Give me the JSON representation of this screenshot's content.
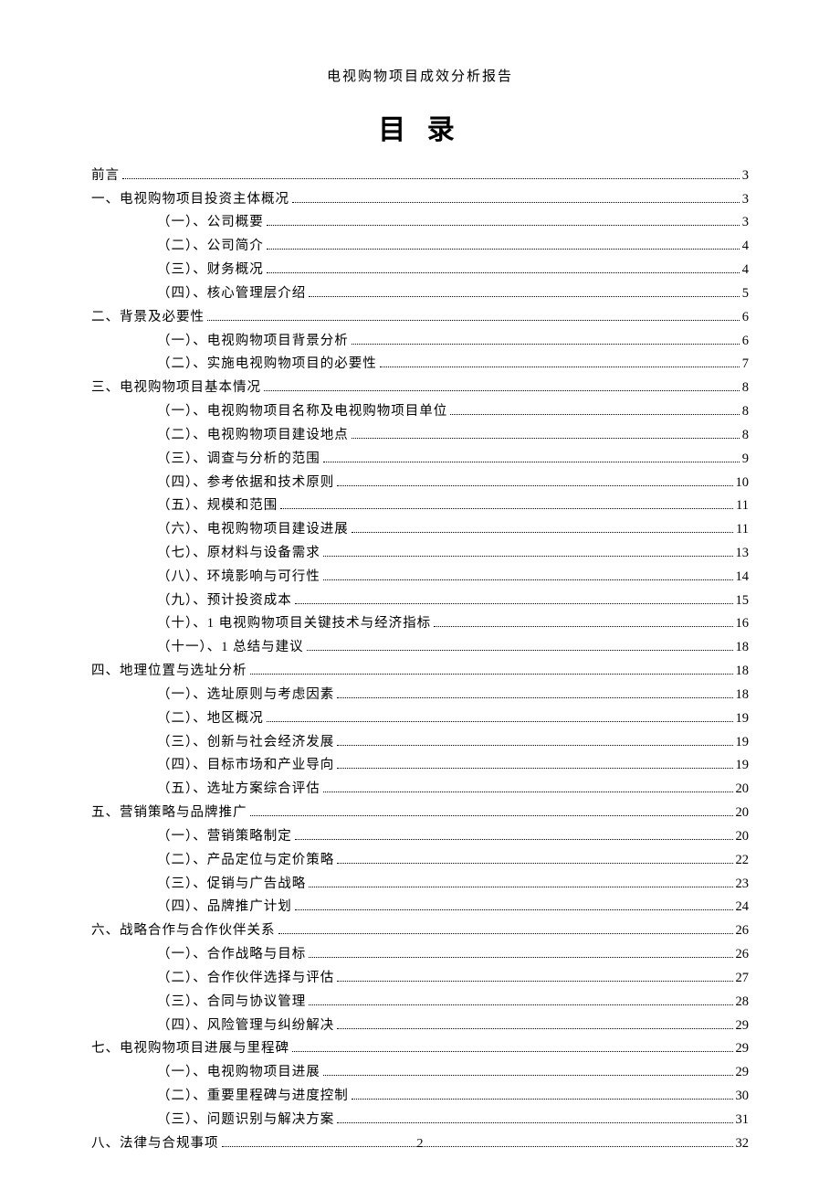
{
  "header": "电视购物项目成效分析报告",
  "title": "目 录",
  "pageNumber": "2",
  "toc": [
    {
      "label": "前言",
      "page": "3",
      "level": 1
    },
    {
      "label": "一、电视购物项目投资主体概况",
      "page": "3",
      "level": 1
    },
    {
      "label": "（一）、公司概要",
      "page": "3",
      "level": 2
    },
    {
      "label": "（二）、公司简介",
      "page": "4",
      "level": 2
    },
    {
      "label": "（三）、财务概况",
      "page": "4",
      "level": 2
    },
    {
      "label": "（四）、核心管理层介绍",
      "page": "5",
      "level": 2
    },
    {
      "label": "二、背景及必要性",
      "page": "6",
      "level": 1
    },
    {
      "label": "（一）、电视购物项目背景分析",
      "page": "6",
      "level": 2
    },
    {
      "label": "（二）、实施电视购物项目的必要性",
      "page": "7",
      "level": 2
    },
    {
      "label": "三、电视购物项目基本情况",
      "page": "8",
      "level": 1
    },
    {
      "label": "（一）、电视购物项目名称及电视购物项目单位",
      "page": "8",
      "level": 2
    },
    {
      "label": "（二）、电视购物项目建设地点",
      "page": "8",
      "level": 2
    },
    {
      "label": "（三）、调查与分析的范围",
      "page": "9",
      "level": 2
    },
    {
      "label": "（四）、参考依据和技术原则",
      "page": "10",
      "level": 2
    },
    {
      "label": "（五）、规模和范围",
      "page": "11",
      "level": 2
    },
    {
      "label": "（六）、电视购物项目建设进展",
      "page": "11",
      "level": 2
    },
    {
      "label": "（七）、原材料与设备需求",
      "page": "13",
      "level": 2
    },
    {
      "label": "（八）、环境影响与可行性",
      "page": "14",
      "level": 2
    },
    {
      "label": "（九）、预计投资成本",
      "page": "15",
      "level": 2
    },
    {
      "label": "（十）、1 电视购物项目关键技术与经济指标",
      "page": "16",
      "level": 2
    },
    {
      "label": "（十一）、1 总结与建议",
      "page": "18",
      "level": 2
    },
    {
      "label": "四、地理位置与选址分析",
      "page": "18",
      "level": 1
    },
    {
      "label": "（一）、选址原则与考虑因素",
      "page": "18",
      "level": 2
    },
    {
      "label": "（二）、地区概况",
      "page": "19",
      "level": 2
    },
    {
      "label": "（三）、创新与社会经济发展",
      "page": "19",
      "level": 2
    },
    {
      "label": "（四）、目标市场和产业导向",
      "page": "19",
      "level": 2
    },
    {
      "label": "（五）、选址方案综合评估",
      "page": "20",
      "level": 2
    },
    {
      "label": "五、营销策略与品牌推广",
      "page": "20",
      "level": 1
    },
    {
      "label": "（一）、营销策略制定",
      "page": "20",
      "level": 2
    },
    {
      "label": "（二）、产品定位与定价策略",
      "page": "22",
      "level": 2
    },
    {
      "label": "（三）、促销与广告战略",
      "page": "23",
      "level": 2
    },
    {
      "label": "（四）、品牌推广计划",
      "page": "24",
      "level": 2
    },
    {
      "label": "六、战略合作与合作伙伴关系",
      "page": "26",
      "level": 1
    },
    {
      "label": "（一）、合作战略与目标",
      "page": "26",
      "level": 2
    },
    {
      "label": "（二）、合作伙伴选择与评估",
      "page": "27",
      "level": 2
    },
    {
      "label": "（三）、合同与协议管理",
      "page": "28",
      "level": 2
    },
    {
      "label": "（四）、风险管理与纠纷解决",
      "page": "29",
      "level": 2
    },
    {
      "label": "七、电视购物项目进展与里程碑",
      "page": "29",
      "level": 1
    },
    {
      "label": "（一）、电视购物项目进展",
      "page": "29",
      "level": 2
    },
    {
      "label": "（二）、重要里程碑与进度控制",
      "page": "30",
      "level": 2
    },
    {
      "label": "（三）、问题识别与解决方案",
      "page": "31",
      "level": 2
    },
    {
      "label": "八、法律与合规事项",
      "page": "32",
      "level": 1
    }
  ]
}
